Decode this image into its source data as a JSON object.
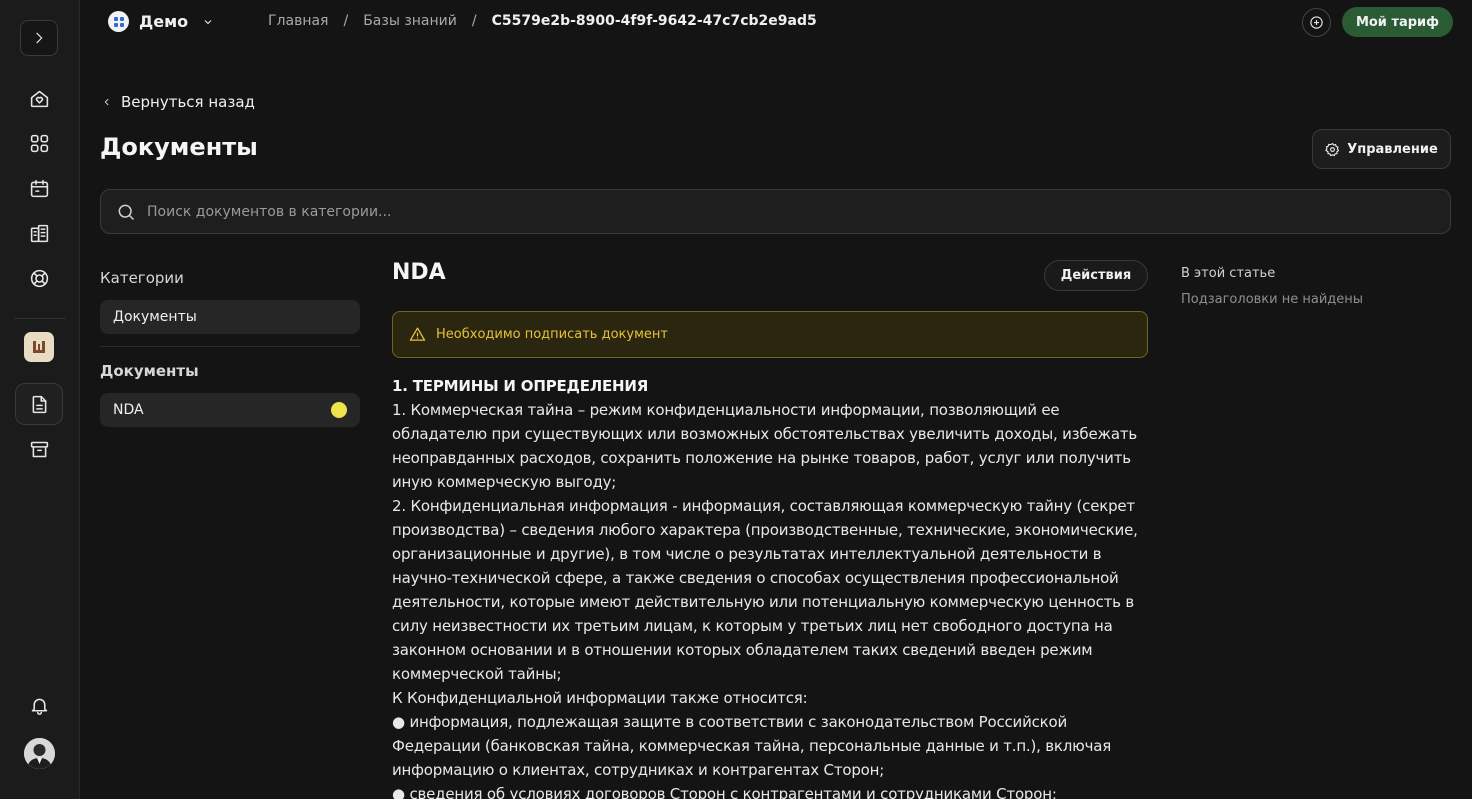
{
  "workspace": {
    "name": "Демо"
  },
  "breadcrumb": {
    "home": "Главная",
    "kb": "Базы знаний",
    "current": "C5579e2b-8900-4f9f-9642-47c7cb2e9ad5",
    "sep": "/"
  },
  "header": {
    "plan_label": "Мой тариф"
  },
  "page": {
    "back_label": "Вернуться назад",
    "title": "Документы",
    "manage_label": "Управление"
  },
  "search": {
    "placeholder": "Поиск документов в категории..."
  },
  "sidebar": {
    "categories_heading": "Категории",
    "categories": [
      {
        "label": "Документы"
      }
    ],
    "documents_heading": "Документы",
    "documents": [
      {
        "label": "NDA",
        "status_color": "#ede34a"
      }
    ]
  },
  "article": {
    "title": "NDA",
    "actions_label": "Действия",
    "warning": "Необходимо подписать документ",
    "lines": [
      "1. ТЕРМИНЫ И ОПРЕДЕЛЕНИЯ",
      "1. Коммерческая тайна – режим конфиденциальности информации, позволяющий ее",
      "обладателю при существующих или возможных обстоятельствах увеличить доходы, избежать",
      "неоправданных расходов, сохранить положение на рынке товаров, работ, услуг или получить",
      "иную коммерческую выгоду;",
      "2. Конфиденциальная информация - информация, составляющая коммерческую тайну (секрет",
      "производства) – сведения любого характера (производственные, технические, экономические,",
      "организационные и другие), в том числе о результатах интеллектуальной деятельности в",
      "научно-технической сфере, а также сведения о способах осуществления профессиональной",
      "деятельности, которые имеют действительную или потенциальную коммерческую ценность в",
      "силу неизвестности их третьим лицам, к которым у третьих лиц нет свободного доступа на",
      "законном основании и в отношении которых обладателем таких сведений введен режим",
      "коммерческой тайны;",
      "К Конфиденциальной информации также относится:",
      "● информация, подлежащая защите в соответствии с законодательством Российской",
      "Федерации (банковская тайна, коммерческая тайна, персональные данные и т.п.), включая",
      "информацию о клиентах, сотрудниках и контрагентах Сторон;",
      "● сведения об условиях договоров Сторон с контрагентами и сотрудниками Сторон;"
    ]
  },
  "toc": {
    "heading": "В этой статье",
    "empty": "Подзаголовки не найдены"
  }
}
